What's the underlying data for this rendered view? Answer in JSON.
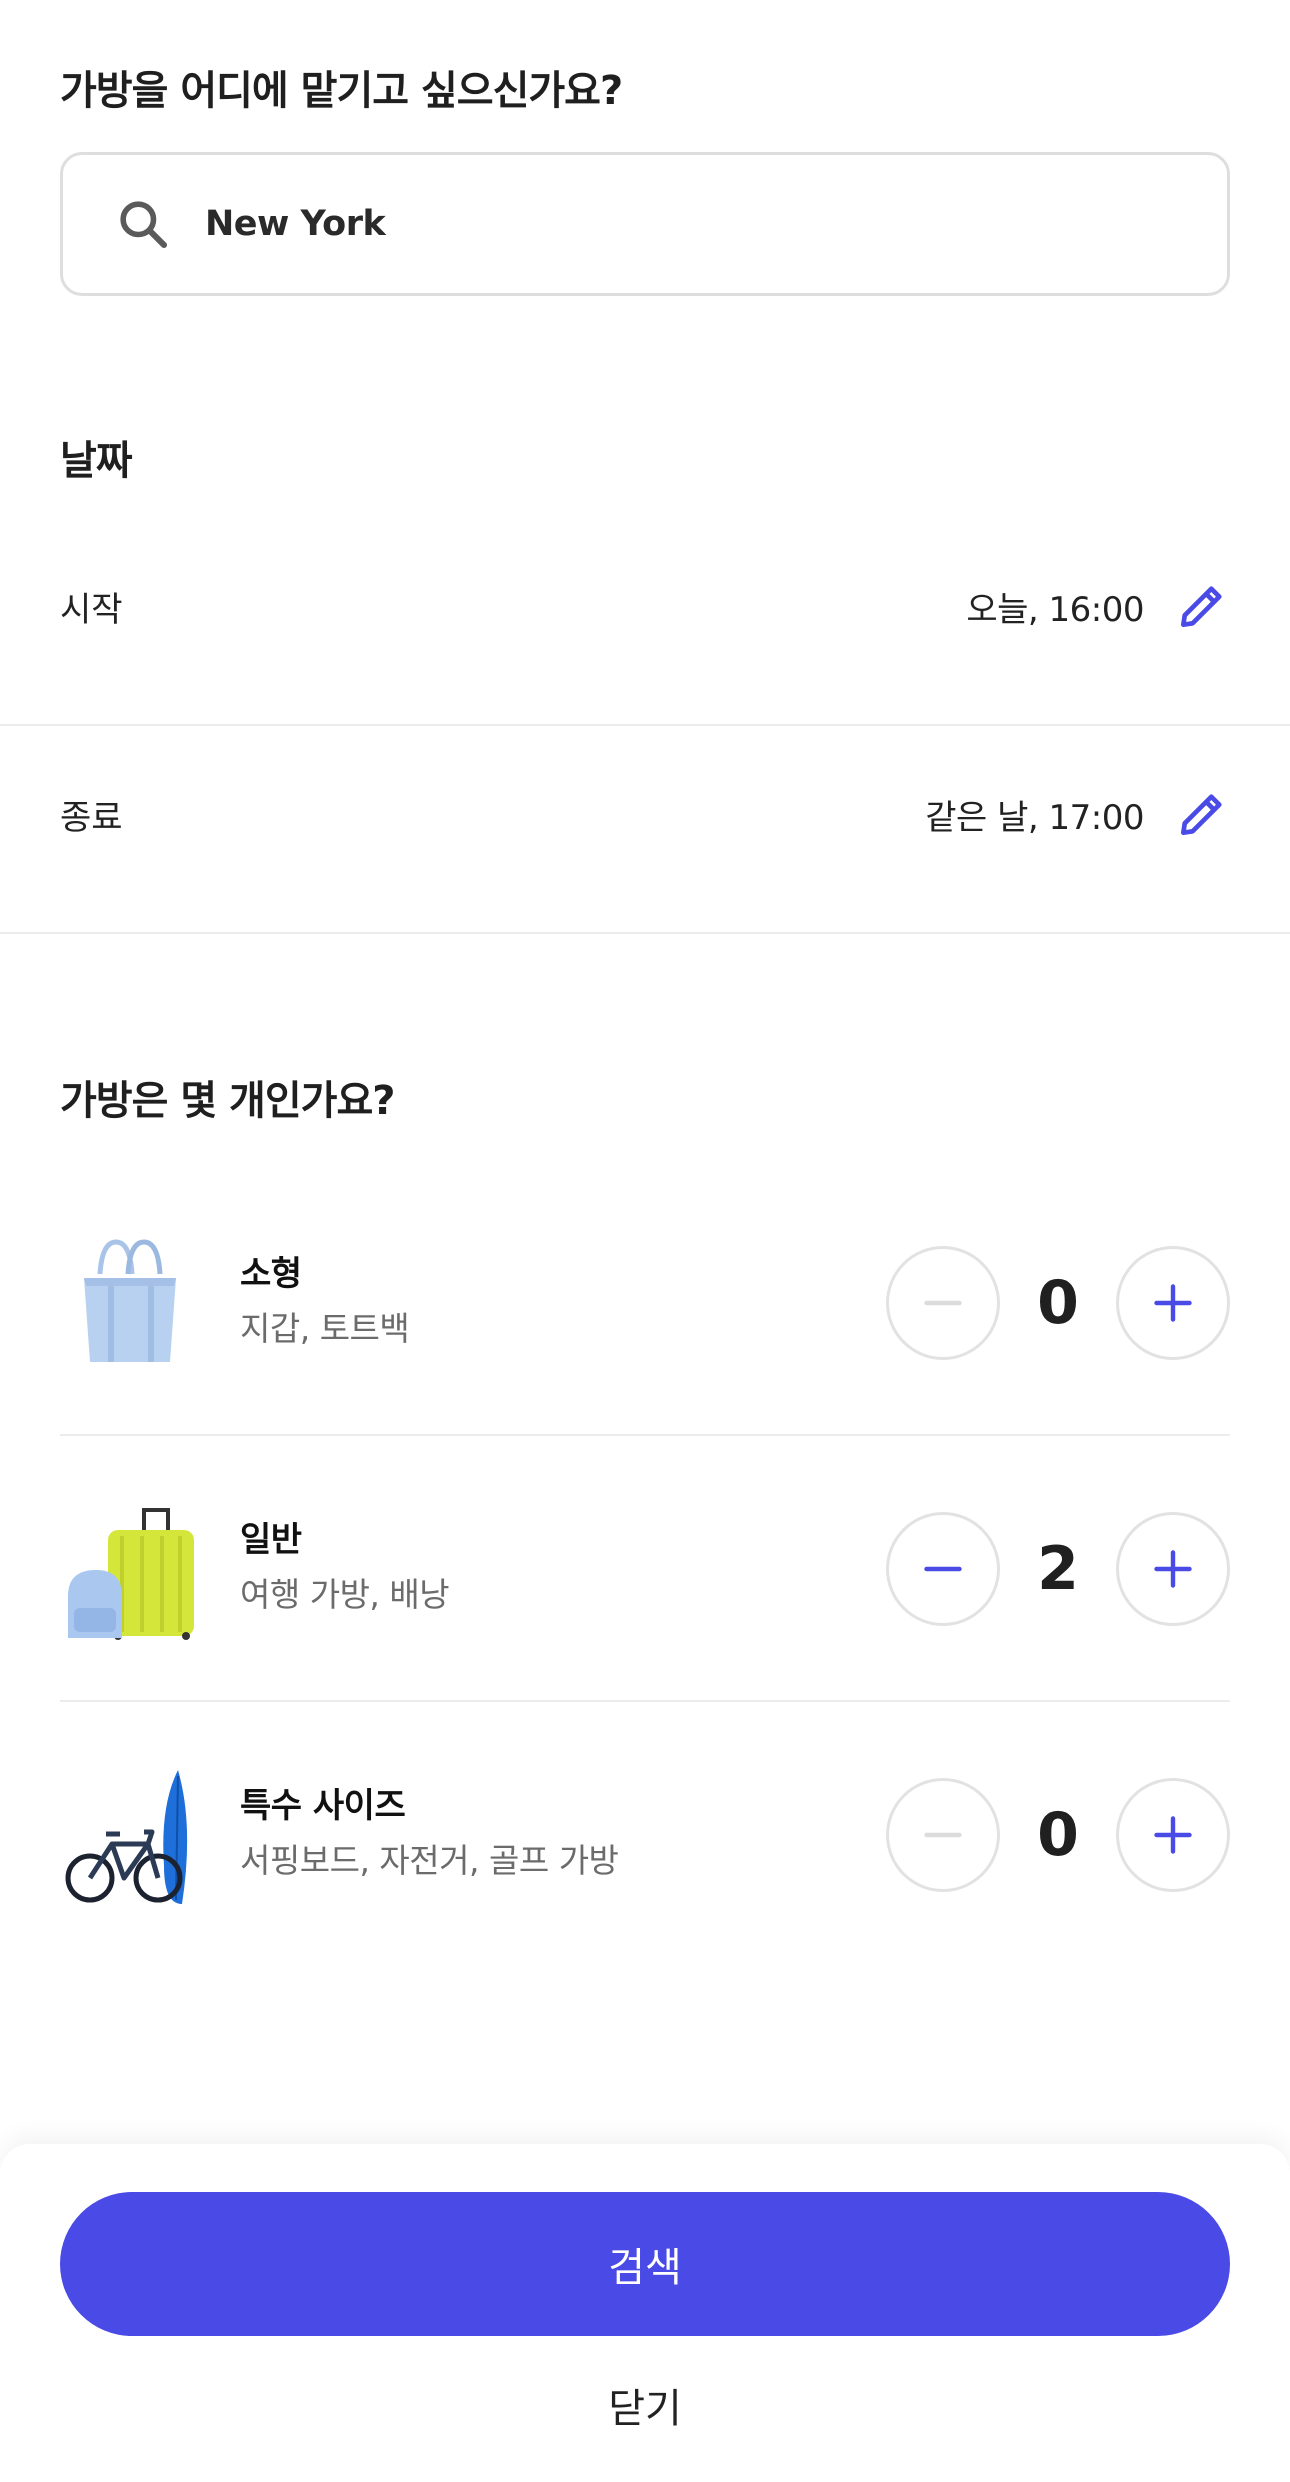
{
  "location": {
    "question": "가방을 어디에 맡기고 싶으신가요?",
    "search_value": "New York",
    "icon": "search-icon"
  },
  "dates": {
    "title": "날짜",
    "start": {
      "label": "시작",
      "value": "오늘, 16:00",
      "icon": "pencil-icon"
    },
    "end": {
      "label": "종료",
      "value": "같은 날, 17:00",
      "icon": "pencil-icon"
    }
  },
  "bags": {
    "title": "가방은 몇 개인가요?",
    "items": [
      {
        "name": "소형",
        "desc": "지갑, 토트백",
        "count": "0",
        "icon": "tote-bag-image"
      },
      {
        "name": "일반",
        "desc": "여행 가방, 배낭",
        "count": "2",
        "icon": "suitcase-backpack-image"
      },
      {
        "name": "특수 사이즈",
        "desc": "서핑보드, 자전거, 골프 가방",
        "count": "0",
        "icon": "bicycle-surfboard-image"
      }
    ]
  },
  "footer": {
    "search_label": "검색",
    "close_label": "닫기"
  },
  "colors": {
    "accent": "#4a4ae6",
    "disabled": "#dcdcdc"
  }
}
